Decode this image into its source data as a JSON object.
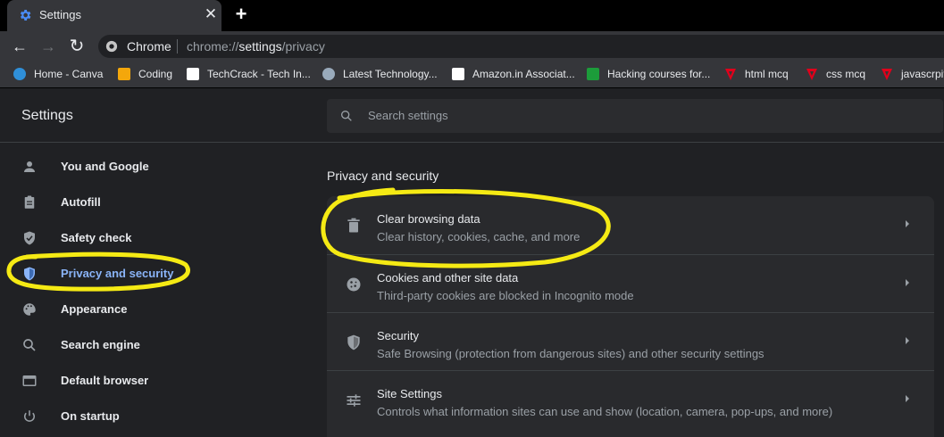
{
  "tab": {
    "title": "Settings",
    "close": "✕",
    "new_tab": "+"
  },
  "toolbar": {
    "back": "←",
    "forward": "→",
    "reload": "↻",
    "site": "Chrome",
    "url_prefix": "chrome://",
    "url_host": "settings",
    "url_path": "/privacy"
  },
  "bookmarks": [
    {
      "label": "Home - Canva",
      "icon": "canva-icon",
      "color": "#2f8fd8"
    },
    {
      "label": "Coding",
      "icon": "blogger-icon",
      "color": "#f4a70b"
    },
    {
      "label": "TechCrack - Tech In...",
      "icon": "techcrack-icon",
      "color": "#ffffff"
    },
    {
      "label": "Latest Technology...",
      "icon": "globe-icon",
      "color": "#9ab"
    },
    {
      "label": "Amazon.in Associat...",
      "icon": "amazon-icon",
      "color": "#ffffff"
    },
    {
      "label": "Hacking courses for...",
      "icon": "tc-icon",
      "color": "#1c9c3a"
    },
    {
      "label": "html mcq",
      "icon": "mcq-icon",
      "color": "#e0001b"
    },
    {
      "label": "css mcq",
      "icon": "mcq-icon",
      "color": "#e0001b"
    },
    {
      "label": "javascrpit",
      "icon": "mcq-icon",
      "color": "#e0001b"
    }
  ],
  "header": {
    "title": "Settings",
    "search_placeholder": "Search settings"
  },
  "sidebar": [
    {
      "label": "You and Google",
      "icon": "person-icon",
      "active": false
    },
    {
      "label": "Autofill",
      "icon": "clipboard-icon",
      "active": false
    },
    {
      "label": "Safety check",
      "icon": "shield-check-icon",
      "active": false
    },
    {
      "label": "Privacy and security",
      "icon": "shield-icon",
      "active": true
    },
    {
      "label": "Appearance",
      "icon": "palette-icon",
      "active": false
    },
    {
      "label": "Search engine",
      "icon": "search-icon",
      "active": false
    },
    {
      "label": "Default browser",
      "icon": "browser-icon",
      "active": false
    },
    {
      "label": "On startup",
      "icon": "power-icon",
      "active": false
    }
  ],
  "main": {
    "section_title": "Privacy and security",
    "rows": [
      {
        "title": "Clear browsing data",
        "subtitle": "Clear history, cookies, cache, and more",
        "icon": "trash-icon"
      },
      {
        "title": "Cookies and other site data",
        "subtitle": "Third-party cookies are blocked in Incognito mode",
        "icon": "cookie-icon"
      },
      {
        "title": "Security",
        "subtitle": "Safe Browsing (protection from dangerous sites) and other security settings",
        "icon": "shield-icon"
      },
      {
        "title": "Site Settings",
        "subtitle": "Controls what information sites can use and show (location, camera, pop-ups, and more)",
        "icon": "sliders-icon"
      }
    ]
  },
  "colors": {
    "highlight": "#f5ea14",
    "accent": "#8ab4f8",
    "background": "#202124"
  }
}
